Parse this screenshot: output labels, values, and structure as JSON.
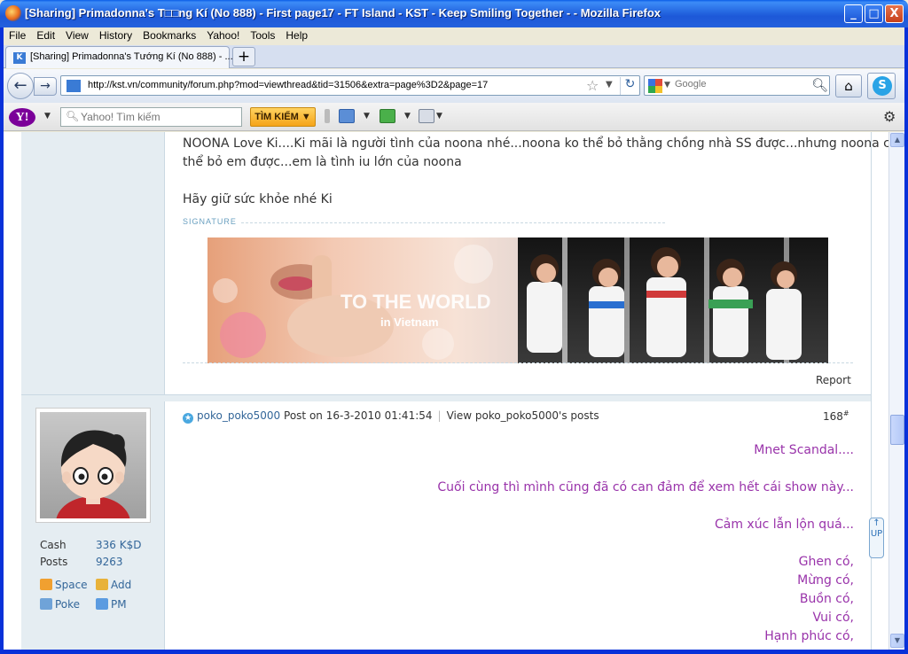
{
  "window": {
    "title": "[Sharing] Primadonna's T□□ng Kí (No 888) - First page17 - FT Island - KST - Keep Smiling Together - - Mozilla Firefox",
    "minimize": "_",
    "maximize": "□",
    "close": "X"
  },
  "menu": [
    "File",
    "Edit",
    "View",
    "History",
    "Bookmarks",
    "Yahoo!",
    "Tools",
    "Help"
  ],
  "tab": {
    "title": "[Sharing] Primadonna's Tướng Kí (No 888) - ...",
    "new_tab": "+"
  },
  "nav": {
    "url": "http://kst.vn/community/forum.php?mod=viewthread&tid=31506&extra=page%3D2&page=17",
    "search_placeholder": "Google"
  },
  "yahoo": {
    "logo": "Y!",
    "search_placeholder": "Yahoo! Tìm kiếm",
    "search_button": "TÌM KIẾM"
  },
  "post1": {
    "lines": [
      "NOONA Love Ki....Ki mãi là người tình của noona nhé...noona ko thể bỏ thằng chồng nhà SS được...nhưng noona cũng ko",
      "thể bỏ em được...em là tình iu lớn của noona",
      "Hãy giữ sức khỏe nhé Ki"
    ],
    "signature_label": "SIGNATURE",
    "banner_text": "TO THE WORLD",
    "banner_subtext": "in Vietnam",
    "report": "Report"
  },
  "post2": {
    "author": "poko_poko5000",
    "meta": "Post on 16-3-2010 01:41:54",
    "view_posts": "View poko_poko5000's posts",
    "number": "168",
    "number_sup": "#",
    "stats": [
      {
        "label": "Cash",
        "value": "336 K$D"
      },
      {
        "label": "Posts",
        "value": "9263"
      }
    ],
    "links": [
      {
        "label": "Space",
        "icon": "home-icon"
      },
      {
        "label": "Add",
        "icon": "handshake-icon"
      },
      {
        "label": "Poke",
        "icon": "poke-icon"
      },
      {
        "label": "PM",
        "icon": "envelope-icon"
      }
    ],
    "lines": [
      "Mnet Scandal....",
      "Cuối cùng thì mình cũng đã có can đảm để xem hết cái show này...",
      "Cảm xúc lẫn lộn quá...",
      "Ghen có,",
      "Mừng có,",
      "Buồn có,",
      "Vui có,",
      "Hạnh phúc có,"
    ],
    "side_tab": "↑ UP"
  },
  "colors": {
    "sidebar_bg": "#e5edf2",
    "post_text_purple": "#9933aa",
    "link_blue": "#336699"
  }
}
